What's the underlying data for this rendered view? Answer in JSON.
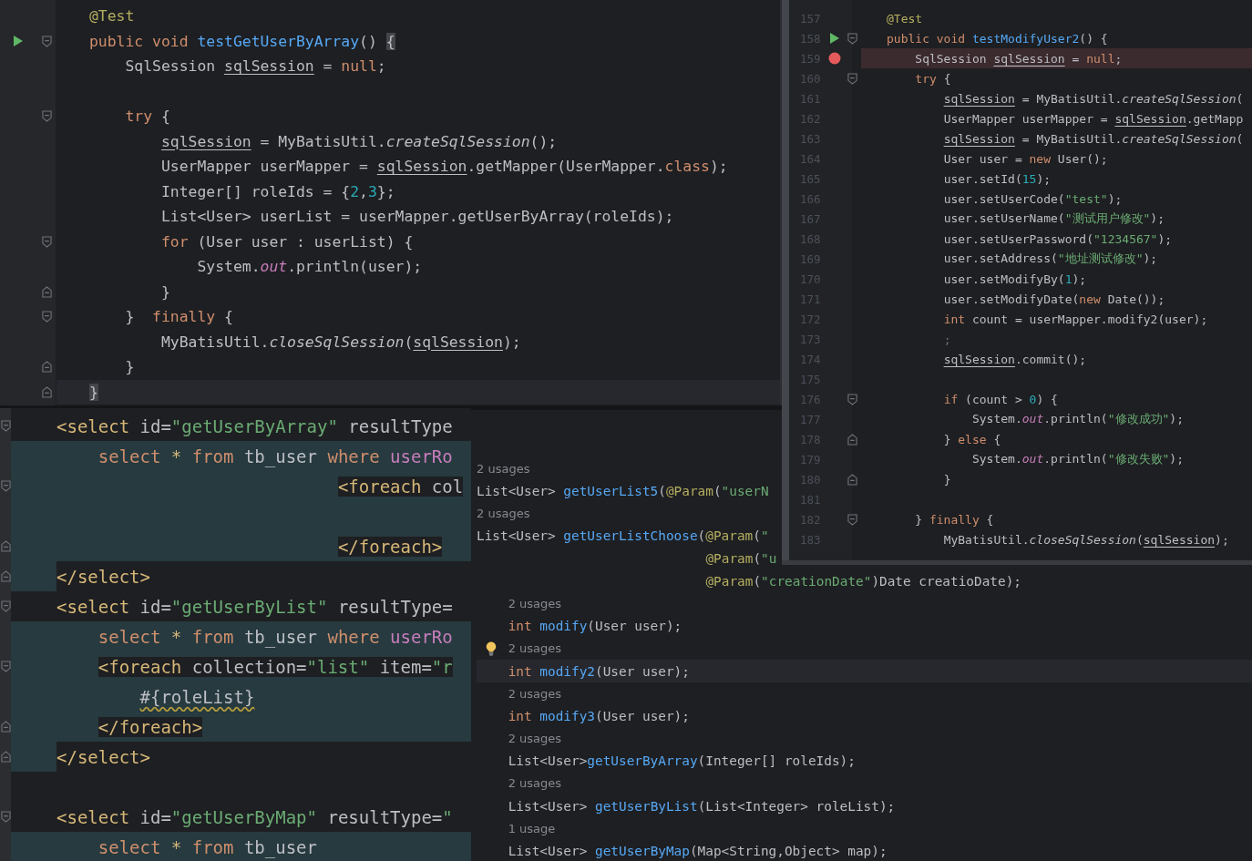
{
  "top_left_editor": {
    "lines": [
      {
        "tokens": [
          {
            "text": "@Test",
            "kind": "ann"
          }
        ]
      },
      {
        "tokens": [
          {
            "text": "public void ",
            "kind": "kw"
          },
          {
            "text": "testGetUserByArray",
            "kind": "fn"
          },
          {
            "text": "() ",
            "kind": "plain"
          },
          {
            "text": "{",
            "kind": "match"
          }
        ],
        "run": true,
        "fold_start": true
      },
      {
        "tokens": [
          {
            "text": "    SqlSession ",
            "kind": "plain"
          },
          {
            "text": "sqlSession",
            "kind": "var"
          },
          {
            "text": " = ",
            "kind": "plain"
          },
          {
            "text": "null",
            "kind": "kw"
          },
          {
            "text": ";",
            "kind": "plain"
          }
        ]
      },
      {
        "gap_before": true,
        "tokens": [
          {
            "text": "    try ",
            "kind": "kw"
          },
          {
            "text": "{",
            "kind": "plain"
          }
        ],
        "fold_start": true
      },
      {
        "tokens": [
          {
            "text": "        sqlSession",
            "kind": "var"
          },
          {
            "text": " = MyBatisUtil.",
            "kind": "plain"
          },
          {
            "text": "createSqlSession",
            "kind": "static"
          },
          {
            "text": "();",
            "kind": "plain"
          }
        ]
      },
      {
        "tokens": [
          {
            "text": "        UserMapper userMapper = ",
            "kind": "plain"
          },
          {
            "text": "sqlSession",
            "kind": "var"
          },
          {
            "text": ".getMapper(UserMapper.",
            "kind": "plain"
          },
          {
            "text": "class",
            "kind": "kw"
          },
          {
            "text": ");",
            "kind": "plain"
          }
        ]
      },
      {
        "tokens": [
          {
            "text": "        Integer[] roleIds = {",
            "kind": "plain"
          },
          {
            "text": "2",
            "kind": "num"
          },
          {
            "text": ",",
            "kind": "plain"
          },
          {
            "text": "3",
            "kind": "num"
          },
          {
            "text": "};",
            "kind": "plain"
          }
        ]
      },
      {
        "tokens": [
          {
            "text": "        List<User> userList = userMapper.getUserByArray(roleIds);",
            "kind": "plain"
          }
        ]
      },
      {
        "tokens": [
          {
            "text": "        for ",
            "kind": "kw"
          },
          {
            "text": "(User user : userList) {",
            "kind": "plain"
          }
        ],
        "fold_start": true
      },
      {
        "tokens": [
          {
            "text": "            System.",
            "kind": "plain"
          },
          {
            "text": "out",
            "kind": "field"
          },
          {
            "text": ".println(user);",
            "kind": "plain"
          }
        ]
      },
      {
        "tokens": [
          {
            "text": "        }",
            "kind": "plain"
          }
        ],
        "fold_end": true
      },
      {
        "tokens": [
          {
            "text": "    }  ",
            "kind": "plain"
          },
          {
            "text": "finally ",
            "kind": "kw"
          },
          {
            "text": "{",
            "kind": "plain"
          }
        ],
        "fold_start": true
      },
      {
        "tokens": [
          {
            "text": "        MyBatisUtil.",
            "kind": "plain"
          },
          {
            "text": "closeSqlSession",
            "kind": "static"
          },
          {
            "text": "(",
            "kind": "plain"
          },
          {
            "text": "sqlSession",
            "kind": "var"
          },
          {
            "text": ");",
            "kind": "plain"
          }
        ]
      },
      {
        "tokens": [
          {
            "text": "    }",
            "kind": "plain"
          }
        ],
        "fold_end": true
      },
      {
        "tokens": [
          {
            "text": "}",
            "kind": "match"
          }
        ],
        "fold_end": true,
        "current": true
      }
    ]
  },
  "xml_editor": {
    "lines": [
      {
        "tokens": [
          {
            "text": "<select",
            "kind": "tag"
          },
          {
            "text": " id=",
            "kind": "attr"
          },
          {
            "text": "\"getUserByArray\"",
            "kind": "str"
          },
          {
            "text": " resultType",
            "kind": "attr"
          }
        ],
        "fold_start": true
      },
      {
        "tokens": [
          {
            "text": "    select ",
            "kind": "sqlkw"
          },
          {
            "text": "* ",
            "kind": "star"
          },
          {
            "text": "from ",
            "kind": "sqlkw"
          },
          {
            "text": "tb_user ",
            "kind": "plain"
          },
          {
            "text": "where ",
            "kind": "sqlkw"
          },
          {
            "text": "userRo",
            "kind": "sqlcol"
          }
        ],
        "injected": true
      },
      {
        "tokens": [
          {
            "text": "                           <foreach ",
            "kind": "tag"
          },
          {
            "text": "col",
            "kind": "attr"
          }
        ],
        "injected": true,
        "fold_start": true
      },
      {
        "injected": true
      },
      {
        "tokens": [
          {
            "text": "                           </foreach>",
            "kind": "tag"
          }
        ],
        "injected": true,
        "fold_end": true
      },
      {
        "tokens": [
          {
            "text": "</select>",
            "kind": "tag"
          }
        ],
        "injected_edge": true,
        "fold_end": true
      },
      {
        "tokens": [
          {
            "text": "<select",
            "kind": "tag"
          },
          {
            "text": " id=",
            "kind": "attr"
          },
          {
            "text": "\"getUserByList\"",
            "kind": "str"
          },
          {
            "text": " resultType=",
            "kind": "attr"
          }
        ],
        "fold_start": true
      },
      {
        "tokens": [
          {
            "text": "    select ",
            "kind": "sqlkw"
          },
          {
            "text": "* ",
            "kind": "star"
          },
          {
            "text": "from ",
            "kind": "sqlkw"
          },
          {
            "text": "tb_user ",
            "kind": "plain"
          },
          {
            "text": "where ",
            "kind": "sqlkw"
          },
          {
            "text": "userRo",
            "kind": "sqlcol"
          }
        ],
        "injected": true
      },
      {
        "tokens": [
          {
            "text": "    <foreach ",
            "kind": "tag"
          },
          {
            "text": "collection=",
            "kind": "attr"
          },
          {
            "text": "\"list\" ",
            "kind": "str"
          },
          {
            "text": "item=",
            "kind": "attr"
          },
          {
            "text": "\"r",
            "kind": "str"
          }
        ],
        "injected": true,
        "fold_start": true
      },
      {
        "tokens": [
          {
            "text": "        #{roleList}",
            "kind": "wavy"
          }
        ],
        "injected": true
      },
      {
        "tokens": [
          {
            "text": "    </foreach>",
            "kind": "tag"
          }
        ],
        "injected": true,
        "fold_end": true
      },
      {
        "tokens": [
          {
            "text": "</select>",
            "kind": "tag"
          }
        ],
        "injected_edge": true,
        "fold_end": true
      },
      {
        "gap_before": true,
        "tokens": [
          {
            "text": "<select",
            "kind": "tag"
          },
          {
            "text": " id=",
            "kind": "attr"
          },
          {
            "text": "\"getUserByMap\"",
            "kind": "str"
          },
          {
            "text": " resultType=",
            "kind": "attr"
          },
          {
            "text": "\"",
            "kind": "str"
          }
        ],
        "fold_start": true
      },
      {
        "tokens": [
          {
            "text": "    select ",
            "kind": "sqlkw"
          },
          {
            "text": "* ",
            "kind": "star"
          },
          {
            "text": "from ",
            "kind": "sqlkw"
          },
          {
            "text": "tb_user",
            "kind": "plain"
          }
        ],
        "injected": true
      }
    ]
  },
  "interface_editor": {
    "lines": [
      {
        "tokens": [
          {
            "text": "2 usages",
            "kind": "hint"
          }
        ]
      },
      {
        "tokens": [
          {
            "text": "List<User> ",
            "kind": "plain"
          },
          {
            "text": "getUserList5",
            "kind": "fn"
          },
          {
            "text": "(",
            "kind": "plain"
          },
          {
            "text": "@Param",
            "kind": "ann"
          },
          {
            "text": "(",
            "kind": "plain"
          },
          {
            "text": "\"userN",
            "kind": "str"
          }
        ]
      },
      {
        "tokens": [
          {
            "text": "2 usages",
            "kind": "hint"
          }
        ]
      },
      {
        "tokens": [
          {
            "text": "List<User> ",
            "kind": "plain"
          },
          {
            "text": "getUserListChoose",
            "kind": "fn"
          },
          {
            "text": "(",
            "kind": "plain"
          },
          {
            "text": "@Param",
            "kind": "ann"
          },
          {
            "text": "(",
            "kind": "plain"
          },
          {
            "text": "\"",
            "kind": "str"
          }
        ]
      },
      {
        "tokens": [
          {
            "text": "                             @Param",
            "kind": "ann"
          },
          {
            "text": "(",
            "kind": "plain"
          },
          {
            "text": "\"u",
            "kind": "str"
          }
        ]
      },
      {
        "tokens": [
          {
            "text": "                             @Param",
            "kind": "ann"
          },
          {
            "text": "(",
            "kind": "plain"
          },
          {
            "text": "\"creationDate\"",
            "kind": "str"
          },
          {
            "text": ")Date creatioDate);",
            "kind": "plain"
          }
        ]
      },
      {
        "tokens": [
          {
            "text": "    2 usages",
            "kind": "hint"
          }
        ]
      },
      {
        "tokens": [
          {
            "text": "    int ",
            "kind": "kw"
          },
          {
            "text": "modify",
            "kind": "fn"
          },
          {
            "text": "(User user);",
            "kind": "plain"
          }
        ]
      },
      {
        "tokens": [
          {
            "text": "    2 usages",
            "kind": "hint"
          }
        ],
        "bulb": true
      },
      {
        "tokens": [
          {
            "text": "    int ",
            "kind": "kw"
          },
          {
            "text": "modify2",
            "kind": "fn"
          },
          {
            "text": "(User user);",
            "kind": "plain"
          }
        ],
        "current": true
      },
      {
        "tokens": [
          {
            "text": "    2 usages",
            "kind": "hint"
          }
        ]
      },
      {
        "tokens": [
          {
            "text": "    int ",
            "kind": "kw"
          },
          {
            "text": "modify3",
            "kind": "fn"
          },
          {
            "text": "(User user);",
            "kind": "plain"
          }
        ]
      },
      {
        "tokens": [
          {
            "text": "    2 usages",
            "kind": "hint"
          }
        ]
      },
      {
        "tokens": [
          {
            "text": "    List<User>",
            "kind": "plain"
          },
          {
            "text": "getUserByArray",
            "kind": "fn"
          },
          {
            "text": "(Integer[] roleIds);",
            "kind": "plain"
          }
        ]
      },
      {
        "tokens": [
          {
            "text": "    2 usages",
            "kind": "hint"
          }
        ]
      },
      {
        "tokens": [
          {
            "text": "    List<User> ",
            "kind": "plain"
          },
          {
            "text": "getUserByList",
            "kind": "fn"
          },
          {
            "text": "(List<Integer> roleList);",
            "kind": "plain"
          }
        ]
      },
      {
        "tokens": [
          {
            "text": "    1 usage",
            "kind": "hint"
          }
        ]
      },
      {
        "tokens": [
          {
            "text": "    List<User> ",
            "kind": "plain"
          },
          {
            "text": "getUserByMap",
            "kind": "fn"
          },
          {
            "text": "(Map<String,Object> map);",
            "kind": "plain"
          }
        ]
      }
    ]
  },
  "top_right_editor": {
    "lines": [
      {
        "num": "157",
        "tokens": [
          {
            "text": "@Test",
            "kind": "ann"
          }
        ]
      },
      {
        "num": "158",
        "tokens": [
          {
            "text": "public void ",
            "kind": "kw"
          },
          {
            "text": "testModifyUser2",
            "kind": "fn"
          },
          {
            "text": "() {",
            "kind": "plain"
          }
        ],
        "run": true,
        "fold_start": true
      },
      {
        "num": "159",
        "tokens": [
          {
            "text": "    SqlSession ",
            "kind": "plain"
          },
          {
            "text": "sqlSession",
            "kind": "var"
          },
          {
            "text": " = ",
            "kind": "plain"
          },
          {
            "text": "null",
            "kind": "kw"
          },
          {
            "text": ";",
            "kind": "plain"
          }
        ],
        "breakpoint": true
      },
      {
        "num": "160",
        "tokens": [
          {
            "text": "    try ",
            "kind": "kw"
          },
          {
            "text": "{",
            "kind": "plain"
          }
        ],
        "fold_start": true
      },
      {
        "num": "161",
        "tokens": [
          {
            "text": "        sqlSession",
            "kind": "var"
          },
          {
            "text": " = MyBatisUtil.",
            "kind": "plain"
          },
          {
            "text": "createSqlSession",
            "kind": "static"
          },
          {
            "text": "(",
            "kind": "plain"
          }
        ]
      },
      {
        "num": "162",
        "tokens": [
          {
            "text": "        UserMapper userMapper = ",
            "kind": "plain"
          },
          {
            "text": "sqlSession",
            "kind": "var"
          },
          {
            "text": ".getMapp",
            "kind": "plain"
          }
        ]
      },
      {
        "num": "163",
        "tokens": [
          {
            "text": "        sqlSession",
            "kind": "var"
          },
          {
            "text": " = MyBatisUtil.",
            "kind": "plain"
          },
          {
            "text": "createSqlSession",
            "kind": "static"
          },
          {
            "text": "(",
            "kind": "plain"
          }
        ]
      },
      {
        "num": "164",
        "tokens": [
          {
            "text": "        User user = ",
            "kind": "plain"
          },
          {
            "text": "new ",
            "kind": "kw"
          },
          {
            "text": "User();",
            "kind": "plain"
          }
        ]
      },
      {
        "num": "165",
        "tokens": [
          {
            "text": "        user.setId(",
            "kind": "plain"
          },
          {
            "text": "15",
            "kind": "num"
          },
          {
            "text": ");",
            "kind": "plain"
          }
        ]
      },
      {
        "num": "166",
        "tokens": [
          {
            "text": "        user.setUserCode(",
            "kind": "plain"
          },
          {
            "text": "\"test\"",
            "kind": "str"
          },
          {
            "text": ");",
            "kind": "plain"
          }
        ]
      },
      {
        "num": "167",
        "tokens": [
          {
            "text": "        user.setUserName(",
            "kind": "plain"
          },
          {
            "text": "\"测试用户修改\"",
            "kind": "str"
          },
          {
            "text": ");",
            "kind": "plain"
          }
        ]
      },
      {
        "num": "168",
        "tokens": [
          {
            "text": "        user.setUserPassword(",
            "kind": "plain"
          },
          {
            "text": "\"1234567\"",
            "kind": "str"
          },
          {
            "text": ");",
            "kind": "plain"
          }
        ]
      },
      {
        "num": "169",
        "tokens": [
          {
            "text": "        user.setAddress(",
            "kind": "plain"
          },
          {
            "text": "\"地址测试修改\"",
            "kind": "str"
          },
          {
            "text": ");",
            "kind": "plain"
          }
        ]
      },
      {
        "num": "170",
        "tokens": [
          {
            "text": "        user.setModifyBy(",
            "kind": "plain"
          },
          {
            "text": "1",
            "kind": "num"
          },
          {
            "text": ");",
            "kind": "plain"
          }
        ]
      },
      {
        "num": "171",
        "tokens": [
          {
            "text": "        user.setModifyDate(",
            "kind": "plain"
          },
          {
            "text": "new ",
            "kind": "kw"
          },
          {
            "text": "Date());",
            "kind": "plain"
          }
        ]
      },
      {
        "num": "172",
        "tokens": [
          {
            "text": "        int ",
            "kind": "kw"
          },
          {
            "text": "count = userMapper.modify2(user);",
            "kind": "plain"
          }
        ]
      },
      {
        "num": "173",
        "tokens": [
          {
            "text": "        ;",
            "kind": "dim"
          }
        ]
      },
      {
        "num": "174",
        "tokens": [
          {
            "text": "        sqlSession",
            "kind": "var"
          },
          {
            "text": ".commit();",
            "kind": "plain"
          }
        ]
      },
      {
        "num": "175"
      },
      {
        "num": "176",
        "tokens": [
          {
            "text": "        if ",
            "kind": "kw"
          },
          {
            "text": "(count > ",
            "kind": "plain"
          },
          {
            "text": "0",
            "kind": "num"
          },
          {
            "text": ") {",
            "kind": "plain"
          }
        ],
        "fold_start": true
      },
      {
        "num": "177",
        "tokens": [
          {
            "text": "            System.",
            "kind": "plain"
          },
          {
            "text": "out",
            "kind": "field"
          },
          {
            "text": ".println(",
            "kind": "plain"
          },
          {
            "text": "\"修改成功\"",
            "kind": "str"
          },
          {
            "text": ");",
            "kind": "plain"
          }
        ]
      },
      {
        "num": "178",
        "tokens": [
          {
            "text": "        } ",
            "kind": "plain"
          },
          {
            "text": "else ",
            "kind": "kw"
          },
          {
            "text": "{",
            "kind": "plain"
          }
        ],
        "fold_end": true
      },
      {
        "num": "179",
        "tokens": [
          {
            "text": "            System.",
            "kind": "plain"
          },
          {
            "text": "out",
            "kind": "field"
          },
          {
            "text": ".println(",
            "kind": "plain"
          },
          {
            "text": "\"修改失败\"",
            "kind": "str"
          },
          {
            "text": ");",
            "kind": "plain"
          }
        ]
      },
      {
        "num": "180",
        "tokens": [
          {
            "text": "        }",
            "kind": "plain"
          }
        ],
        "fold_end": true
      },
      {
        "num": "181"
      },
      {
        "num": "182",
        "tokens": [
          {
            "text": "    } ",
            "kind": "plain"
          },
          {
            "text": "finally ",
            "kind": "kw"
          },
          {
            "text": "{",
            "kind": "plain"
          }
        ],
        "fold_start": true
      },
      {
        "num": "183",
        "tokens": [
          {
            "text": "        MyBatisUtil.",
            "kind": "plain"
          },
          {
            "text": "closeSqlSession",
            "kind": "static"
          },
          {
            "text": "(",
            "kind": "plain"
          },
          {
            "text": "sqlSession",
            "kind": "var"
          },
          {
            "text": ");",
            "kind": "plain"
          }
        ]
      }
    ]
  }
}
